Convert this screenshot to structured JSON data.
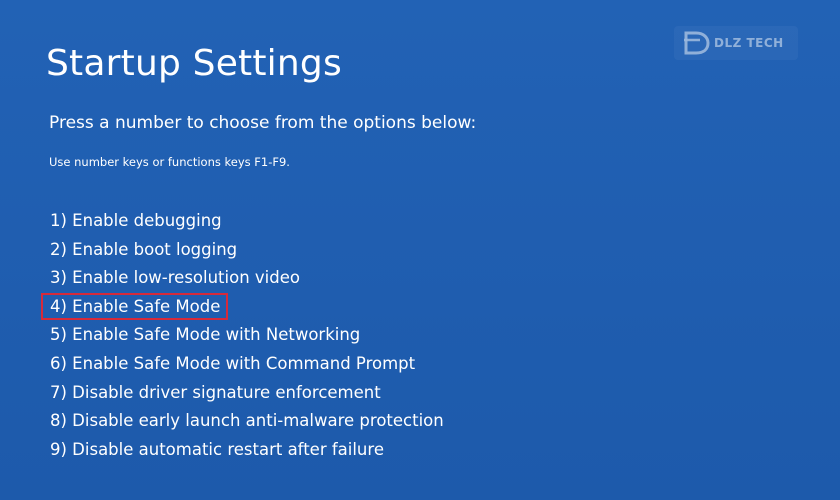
{
  "screen": {
    "title": "Startup Settings",
    "subtitle": "Press a number to choose from the options below:",
    "hint": "Use number keys or functions keys F1-F9."
  },
  "options": [
    {
      "label": "1) Enable debugging",
      "highlighted": false
    },
    {
      "label": "2) Enable boot logging",
      "highlighted": false
    },
    {
      "label": "3) Enable low-resolution video",
      "highlighted": false
    },
    {
      "label": "4) Enable Safe Mode",
      "highlighted": true
    },
    {
      "label": "5) Enable Safe Mode with Networking",
      "highlighted": false
    },
    {
      "label": "6) Enable Safe Mode with Command Prompt",
      "highlighted": false
    },
    {
      "label": "7) Disable driver signature enforcement",
      "highlighted": false
    },
    {
      "label": "8) Disable early launch anti-malware protection",
      "highlighted": false
    },
    {
      "label": "9) Disable automatic restart after failure",
      "highlighted": false
    }
  ],
  "watermark": {
    "text": "DLZ TECH",
    "logo": "dlz-logo"
  },
  "colors": {
    "background": "#1f5fb3",
    "text": "#ffffff",
    "highlight_border": "#d62a3a"
  }
}
